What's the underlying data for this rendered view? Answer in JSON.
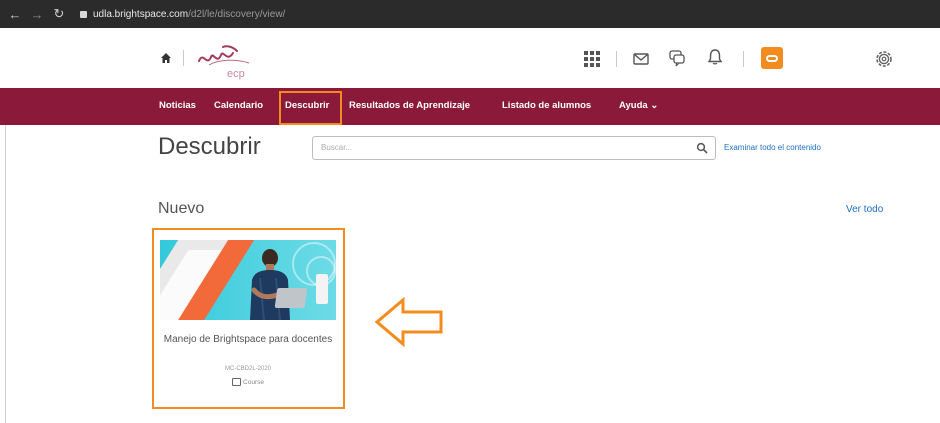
{
  "browser": {
    "back_icon": "arrow-left-icon",
    "forward_icon": "arrow-right-icon",
    "reload_icon": "reload-icon",
    "url_host": "udla.brightspace.com",
    "url_path": "/d2l/le/discovery/view/"
  },
  "header": {
    "logo_text": "udla ecp",
    "icons": [
      "home-icon",
      "course-selector-grid-icon",
      "mail-icon",
      "chat-icon",
      "notification-bell-icon",
      "profile-icon",
      "settings-gear-icon"
    ]
  },
  "nav": {
    "items": [
      "Noticias",
      "Calendario",
      "Descubrir",
      "Resultados de Aprendizaje",
      "Listado de alumnos",
      "Ayuda"
    ],
    "active": "Descubrir"
  },
  "page": {
    "title": "Descubrir",
    "search_placeholder": "Buscar...",
    "browse_all": "Examinar todo el contenido"
  },
  "section": {
    "title": "Nuevo",
    "view_all": "Ver todo"
  },
  "course": {
    "title": "Manejo de Brightspace para docentes",
    "code": "MC-CBD2L-2020",
    "type": "Course"
  },
  "colors": {
    "nav_bg": "#8b1a3a",
    "highlight": "#f28c1e",
    "link": "#1e6fc0"
  }
}
